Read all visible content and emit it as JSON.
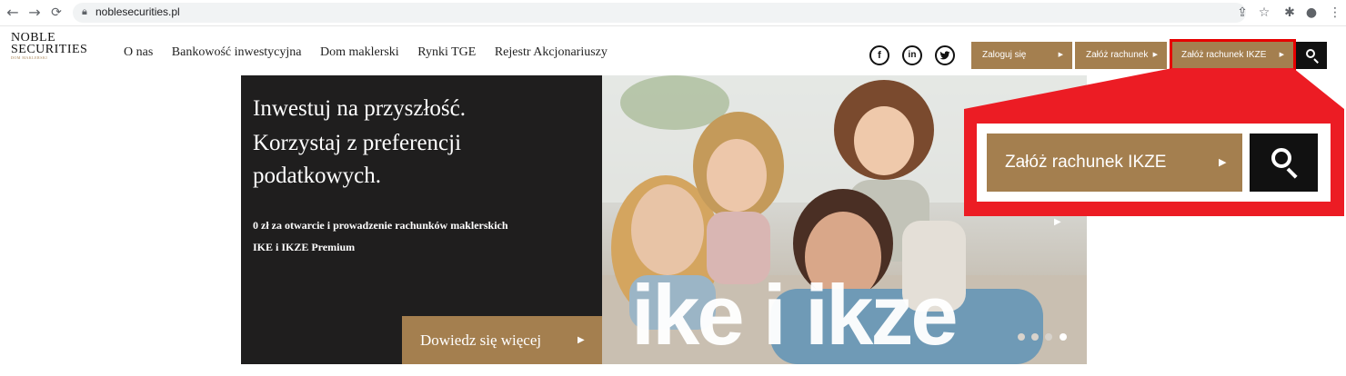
{
  "browser": {
    "url": "noblesecurities.pl",
    "nav_back_icon": "←",
    "nav_forward_icon": "→",
    "reload_icon": "C"
  },
  "header": {
    "logo": {
      "line1": "NOBLE",
      "line2": "SECURITIES",
      "tagline": "DOM MAKLERSKI"
    },
    "nav": [
      "O nas",
      "Bankowość inwestycyjna",
      "Dom maklerski",
      "Rynki TGE",
      "Rejestr Akcjonariuszy"
    ],
    "social": {
      "facebook": "f",
      "linkedin": "in",
      "twitter": "t"
    },
    "buttons": {
      "login": "Zaloguj się",
      "open_account": "Załóż rachunek",
      "open_ikze": "Załóż rachunek IKZE"
    }
  },
  "hero": {
    "headline": [
      "Inwestuj na przyszłość.",
      "Korzystaj z preferencji",
      "podatkowych."
    ],
    "subtext": [
      "0 zł za otwarcie i prowadzenie rachunków maklerskich",
      "IKE i IKZE Premium"
    ],
    "cta": "Dowiedz się więcej",
    "brand_text": "ike i ikze",
    "slides": {
      "count": 4,
      "active": 4
    }
  },
  "callout": {
    "button_label": "Załóż rachunek IKZE"
  },
  "colors": {
    "brand_gold": "#a47f4f",
    "dark": "#1f1e1e",
    "highlight": "#ec1c24"
  }
}
